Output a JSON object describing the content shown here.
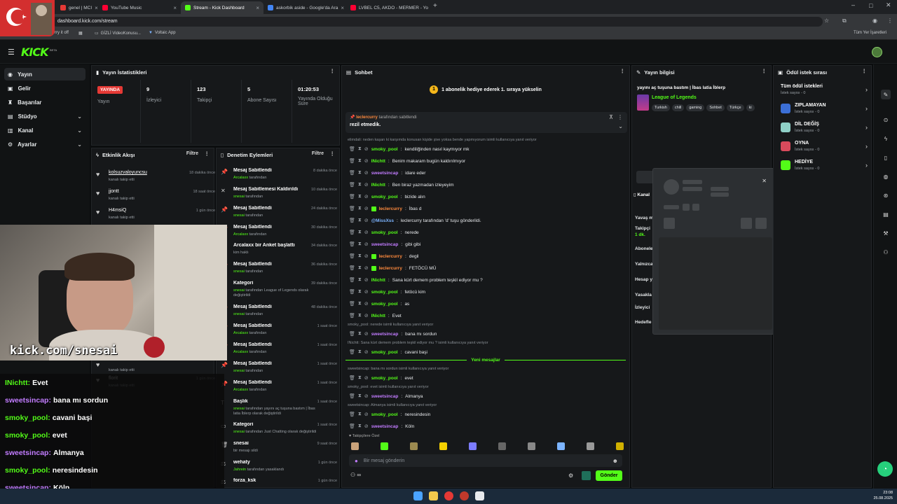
{
  "browser": {
    "tabs": [
      {
        "label": "genel | MCI",
        "color": "#e53935"
      },
      {
        "label": "YouTube Music",
        "color": "#ff0033"
      },
      {
        "label": "Stream - Kick Dashboard",
        "color": "#53fc18"
      },
      {
        "label": "askorbik aside - Google'da Ara",
        "color": "#4285f4"
      },
      {
        "label": "LVBEL C5, AKDO - MERMER - Yo",
        "color": "#ff0033"
      }
    ],
    "url": "dashboard.kick.com/stream",
    "bookmarks": [
      "rry it off",
      "GİZLİ VideoKonusu...",
      "Voltaic App"
    ],
    "all_bookmarks": "Tüm Yer İşaretleri"
  },
  "kick": {
    "logo": "KICK",
    "beta": "BETA"
  },
  "nav": {
    "items": [
      {
        "label": "Yayın",
        "icon": "broadcast-icon"
      },
      {
        "label": "Gelir",
        "icon": "money-icon"
      },
      {
        "label": "Başarılar",
        "icon": "trophy-icon"
      },
      {
        "label": "Stüdyo",
        "icon": "studio-icon"
      },
      {
        "label": "Kanal",
        "icon": "channel-icon"
      },
      {
        "label": "Ayarlar",
        "icon": "settings-icon"
      }
    ]
  },
  "stats": {
    "title": "Yayın İstatistikleri",
    "live_badge": "YAYINDA",
    "live_label": "Yayın",
    "items": [
      {
        "value": "9",
        "label": "İzleyici"
      },
      {
        "value": "123",
        "label": "Takipçi"
      },
      {
        "value": "5",
        "label": "Abone Sayısı"
      },
      {
        "value": "01:20:53",
        "label": "Yayında Olduğu Süre"
      }
    ]
  },
  "activity": {
    "title": "Etkinlik Akışı",
    "filter": "Filtre",
    "items": [
      {
        "name": "kolsuzvaloyuncsu",
        "sub": "kanalı takip etti",
        "time": "18 dakika önce"
      },
      {
        "name": "jjontt",
        "sub": "kanalı takip etti",
        "time": "18 saat önce"
      },
      {
        "name": "H4msiQ",
        "sub": "kanalı takip etti",
        "time": "1 gün önce"
      },
      {
        "name": "",
        "sub": "kanalı takip etti",
        "time": ""
      },
      {
        "name": "florit",
        "sub": "kanalı takip etti",
        "time": "1 gün önce"
      }
    ]
  },
  "moderation": {
    "title": "Denetim Eylemleri",
    "filter": "Filtre",
    "items": [
      {
        "title": "Mesaj Sabitlendi",
        "sub_user": "Arcalaxx",
        "sub": " tarafından",
        "time": "8 dakika önce"
      },
      {
        "title": "Mesaj Sabitlemesi Kaldırıldı",
        "sub_user": "snesai",
        "sub": " tarafından",
        "time": "10 dakika önce"
      },
      {
        "title": "Mesaj Sabitlendi",
        "sub_user": "snesai",
        "sub": " tarafından",
        "time": "24 dakika önce"
      },
      {
        "title": "Mesaj Sabitlendi",
        "sub_user": "Arcalaxx",
        "sub": " tarafından",
        "time": "30 dakika önce"
      },
      {
        "title": "Arcalaxx bir Anket başlattı",
        "sub_user": "",
        "sub": "kim haklı",
        "time": "34 dakika önce"
      },
      {
        "title": "Mesaj Sabitlendi",
        "sub_user": "snesai",
        "sub": " tarafından",
        "time": "36 dakika önce"
      },
      {
        "title": "Kategori",
        "sub_user": "snesai",
        "sub": " tarafından League of Legends olarak değiştirildi",
        "time": "39 dakika önce"
      },
      {
        "title": "Mesaj Sabitlendi",
        "sub_user": "snesai",
        "sub": " tarafından",
        "time": "48 dakika önce"
      },
      {
        "title": "Mesaj Sabitlendi",
        "sub_user": "Arcalaxx",
        "sub": " tarafından",
        "time": "1 saat önce"
      },
      {
        "title": "Mesaj Sabitlendi",
        "sub_user": "Arcalaxx",
        "sub": " tarafından",
        "time": "1 saat önce"
      },
      {
        "title": "Mesaj Sabitlendi",
        "sub_user": "snesai",
        "sub": " tarafından",
        "time": "1 saat önce"
      },
      {
        "title": "Mesaj Sabitlendi",
        "sub_user": "Arcalaxx",
        "sub": " tarafından",
        "time": "1 saat önce"
      },
      {
        "title": "Başlık",
        "sub_user": "snesai",
        "sub": " tarafından yayını aç tuşuna bastım | İbas latia İblerp olarak değiştirildi",
        "time": "1 saat önce"
      },
      {
        "title": "Kategori",
        "sub_user": "snesai",
        "sub": " tarafından Just Chatting olarak değiştirildi",
        "time": "1 saat önce"
      },
      {
        "title": "snesai",
        "sub_user": "",
        "sub": "bir mesajı sildi",
        "time": "9 saat önce"
      },
      {
        "title": "wehaty",
        "sub_user": "Jahrein",
        "sub": " tarafından yasaklandı",
        "time": "1 gün önce"
      },
      {
        "title": "forza_ksk",
        "sub_user": "",
        "sub": "",
        "time": "1 gün önce"
      }
    ]
  },
  "webcam": {
    "watermark": "kick.com/snesai"
  },
  "overlay_chat": [
    {
      "user": "INichtt",
      "msg": "Evet",
      "color": "og"
    },
    {
      "user": "sweetsincap",
      "msg": "bana mı sordun",
      "color": "on"
    },
    {
      "user": "smoky_pool",
      "msg": "cavani başi",
      "color": "og"
    },
    {
      "user": "smoky_pool",
      "msg": "evet",
      "color": "og"
    },
    {
      "user": "sweetsincap",
      "msg": "Almanya",
      "color": "on"
    },
    {
      "user": "smoky_pool",
      "msg": "neresindesin",
      "color": "og"
    },
    {
      "user": "sweetsincap",
      "msg": "Köln",
      "color": "on"
    }
  ],
  "chat": {
    "title": "Sohbet",
    "banner": "1 abonelik hediye ederek 1. sıraya yükselin",
    "pinned_by": "leclercurry",
    "pinned_suffix": " tarafından sabitlendi",
    "pinned_msg": "rezil etmedik.",
    "new_messages": "Yeni mesajlar",
    "followers_only": "Takipçilere Özel",
    "input_placeholder": "Bir mesaj gönderin",
    "send": "Gönder",
    "messages": [
      {
        "type": "reply",
        "text": "elimdali: neden kaşarı ki karşımda konusan kişide şive yoksa bende yapmıyorum isimli kullanıcıya yanıt veriyor"
      },
      {
        "type": "msg",
        "user": "smoky_pool",
        "c": "green",
        "msg": "kendiliğinden nasıl kaymıyor mk"
      },
      {
        "type": "msg",
        "user": "INichtt",
        "c": "green",
        "msg": "Benim makaram bugün kaldırılmıyor"
      },
      {
        "type": "msg",
        "user": "sweetsincap",
        "c": "purple",
        "msg": "idare eder"
      },
      {
        "type": "msg",
        "user": "INichtt",
        "c": "green",
        "msg": "Ben biraz yazmadan izleyeyim"
      },
      {
        "type": "msg",
        "user": "smoky_pool",
        "c": "green",
        "msg": "bizide alın"
      },
      {
        "type": "msg",
        "user": "leclercurry",
        "c": "orange",
        "msg": "İbas d"
      },
      {
        "type": "msg",
        "user": "@MissXss",
        "c": "blue",
        "msg": "leclercurry tarafından 'd' tuşu gönderildi."
      },
      {
        "type": "msg",
        "user": "smoky_pool",
        "c": "green",
        "msg": "nerede"
      },
      {
        "type": "msg",
        "user": "sweetsincap",
        "c": "purple",
        "msg": "gibi gibi"
      },
      {
        "type": "msg",
        "user": "leclercurry",
        "c": "orange",
        "msg": "degil"
      },
      {
        "type": "msg",
        "user": "leclercurry",
        "c": "orange",
        "msg": "FETÖCÜ MÜ"
      },
      {
        "type": "msg",
        "user": "INichtt",
        "c": "green",
        "msg": "Sana kürt demem problem teşkil ediyor mu ?"
      },
      {
        "type": "msg",
        "user": "smoky_pool",
        "c": "green",
        "msg": "fetöcü kim"
      },
      {
        "type": "msg",
        "user": "smoky_pool",
        "c": "green",
        "msg": "as"
      },
      {
        "type": "msg",
        "user": "INichtt",
        "c": "green",
        "msg": "Evet"
      },
      {
        "type": "reply",
        "text": "smoky_pool: nerede isimli kullanıcıya yanıt veriyor"
      },
      {
        "type": "msg",
        "user": "sweetsincap",
        "c": "purple",
        "msg": "bana mı sordun"
      },
      {
        "type": "reply",
        "text": "INichtt: Sana kürt demem problem teşkil ediyor mu ? isimli kullanıcıya yanıt veriyor"
      },
      {
        "type": "msg",
        "user": "smoky_pool",
        "c": "green",
        "msg": "cavani başi"
      }
    ],
    "messages_after": [
      {
        "type": "reply",
        "text": "sweetsincap: bana mı sordun isimli kullanıcıya yanıt veriyor"
      },
      {
        "type": "msg",
        "user": "smoky_pool",
        "c": "green",
        "msg": "evet"
      },
      {
        "type": "reply",
        "text": "smoky_pool: evet isimli kullanıcıya yanıt veriyor"
      },
      {
        "type": "msg",
        "user": "sweetsincap",
        "c": "purple",
        "msg": "Almanya"
      },
      {
        "type": "reply",
        "text": "sweetsincap: Almanya isimli kullanıcıya yanıt veriyor"
      },
      {
        "type": "msg",
        "user": "smoky_pool",
        "c": "green",
        "msg": "neresindesin"
      },
      {
        "type": "msg",
        "user": "sweetsincap",
        "c": "purple",
        "msg": "Köln"
      }
    ]
  },
  "streaminfo": {
    "title": "Yayın bilgisi",
    "stream_title": "yayını aç tuşuna bastım | İbas latia İblerp",
    "category": "League of Legends",
    "tags": [
      "Turkish",
      "chill",
      "gaming",
      "Sohbet",
      "Türkçe",
      "ki"
    ]
  },
  "channel_settings": {
    "title": "Kanal",
    "rows": [
      "Yavaş m",
      "Takipçi",
      "1 dk.",
      "Abonele",
      "Yalnızca",
      "Hesap y",
      "Yasakla",
      "İzleyici",
      "Hedefle"
    ]
  },
  "rewards": {
    "title": "Ödül istek sırası",
    "all": "Tüm ödül istekleri",
    "all_sub": "İstek sayısı - 0",
    "items": [
      {
        "title": "ZIPLAMAYAN",
        "sub": "İstek sayısı - 0",
        "color": "#3b6fd6"
      },
      {
        "title": "DİL DEĞİŞ",
        "sub": "İstek sayısı - 0",
        "color": "#8fd0c7"
      },
      {
        "title": "OYNA",
        "sub": "İstek sayısı - 0",
        "color": "#d94a5c"
      },
      {
        "title": "HEDİYE",
        "sub": "İstek sayısı - 0",
        "color": "#53fc18"
      }
    ]
  },
  "taskbar": {
    "time": "23:08",
    "date": "25.08.2025"
  }
}
